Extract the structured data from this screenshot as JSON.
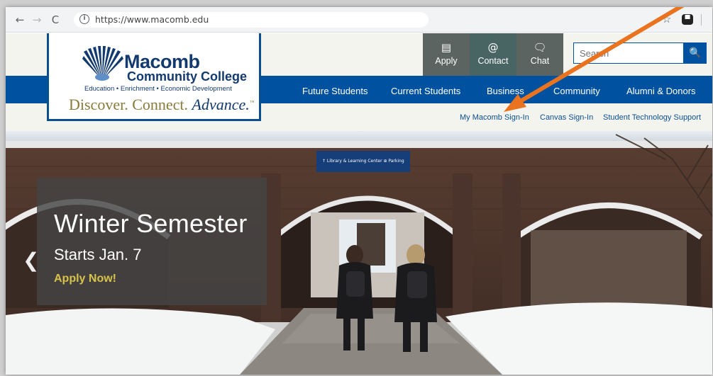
{
  "browser": {
    "url": "https://www.macomb.edu",
    "back_glyph": "←",
    "forward_glyph": "→",
    "reload_glyph": "C",
    "info_glyph": "i",
    "star_glyph": "☆",
    "extension_glyph": "▀"
  },
  "logo": {
    "name": "Macomb",
    "subname": "Community College",
    "tagline": "Education • Enrichment • Economic Development",
    "motto_main": "Discover. Connect. ",
    "motto_em": "Advance.",
    "tm": "™"
  },
  "utility": [
    {
      "label": "Apply",
      "icon": "▤"
    },
    {
      "label": "Contact",
      "icon": "@"
    },
    {
      "label": "Chat",
      "icon": "🗨"
    }
  ],
  "search": {
    "placeholder": "Search",
    "button_glyph": "🔍"
  },
  "main_nav": [
    "Future Students",
    "Current Students",
    "Business",
    "Community",
    "Alumni & Donors"
  ],
  "sub_links": [
    "My Macomb Sign-In",
    "Canvas Sign-In",
    "Student Technology Support"
  ],
  "hero": {
    "title": "Winter Semester",
    "subtitle": "Starts Jan. 7",
    "cta": "Apply Now!",
    "prev_glyph": "❮",
    "sign_text": "↑ Library & Learning Center ⊕ Parking"
  },
  "colors": {
    "brand_blue": "#0052a0",
    "annotation_arrow": "#e9731f",
    "cta_gold": "#d8c34a"
  }
}
